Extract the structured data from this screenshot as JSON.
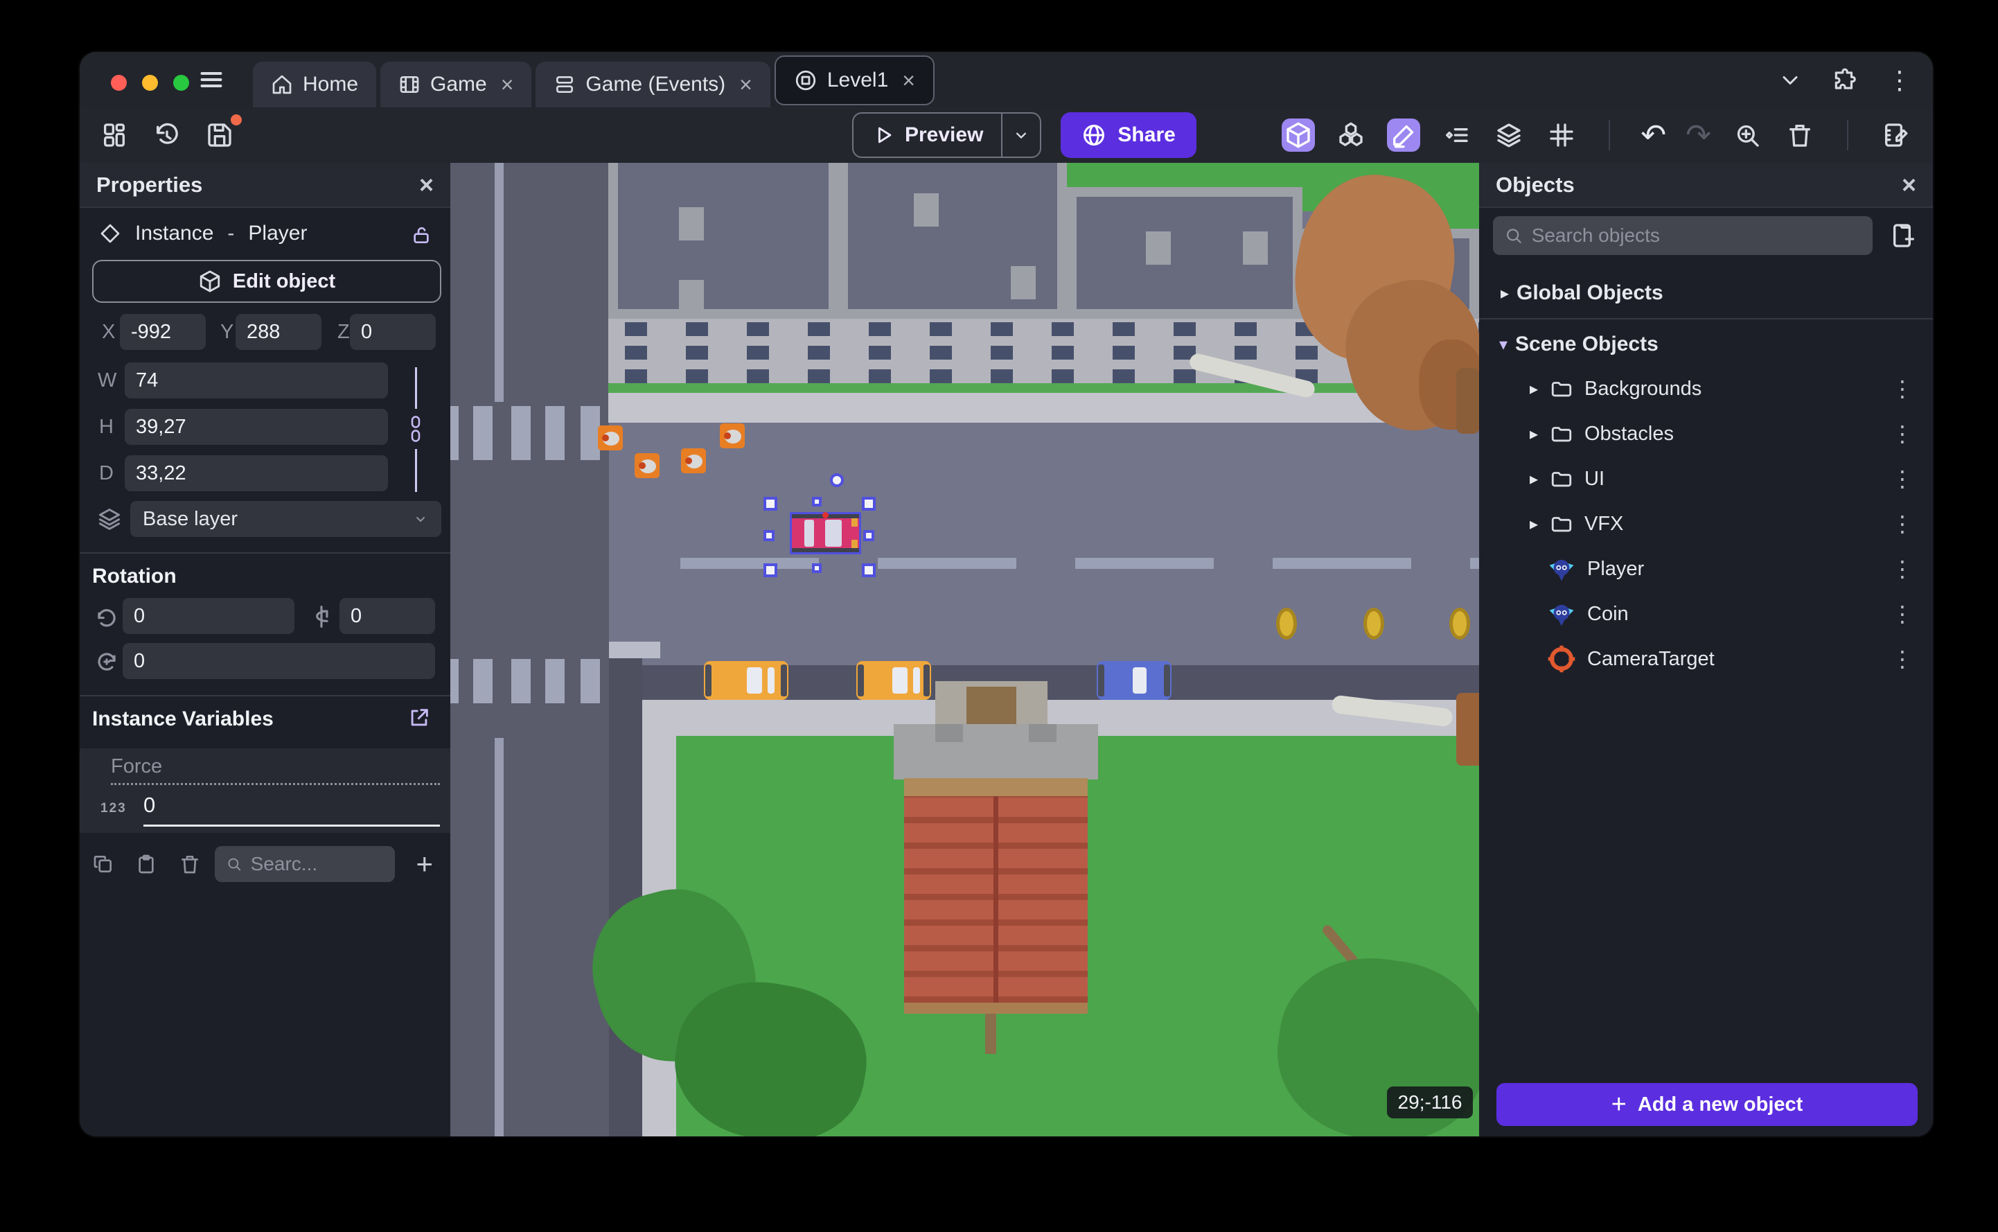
{
  "icons": {
    "close": "×",
    "kebab": "⋮",
    "chevron_right": "▸",
    "chevron_down": "▾",
    "plus": "+",
    "undo": "↶",
    "redo": "↷"
  },
  "tabs": [
    {
      "label": "Home"
    },
    {
      "label": "Game"
    },
    {
      "label": "Game (Events)"
    },
    {
      "label": "Level1"
    }
  ],
  "toolbar": {
    "preview": "Preview",
    "share": "Share"
  },
  "properties": {
    "title": "Properties",
    "instance_type": "Instance",
    "separator": "-",
    "instance_name": "Player",
    "edit_object": "Edit object",
    "labels": {
      "x": "X",
      "y": "Y",
      "z": "Z",
      "w": "W",
      "h": "H",
      "d": "D"
    },
    "x": "-992",
    "y": "288",
    "z": "0",
    "w": "74",
    "h": "39,27",
    "d": "33,22",
    "layer": "Base layer",
    "rotation_title": "Rotation",
    "rot_x": "0",
    "rot_y": "0",
    "rot_z": "0",
    "variables_title": "Instance Variables",
    "variable": {
      "name": "Force",
      "type": "123",
      "value": "0"
    },
    "search_placeholder": "Searc..."
  },
  "objects": {
    "title": "Objects",
    "search_placeholder": "Search objects",
    "global_group": "Global Objects",
    "scene_group": "Scene Objects",
    "tree": [
      {
        "label": "Backgrounds",
        "kind": "folder"
      },
      {
        "label": "Obstacles",
        "kind": "folder"
      },
      {
        "label": "UI",
        "kind": "folder"
      },
      {
        "label": "VFX",
        "kind": "folder"
      },
      {
        "label": "Player",
        "kind": "object"
      },
      {
        "label": "Coin",
        "kind": "object"
      },
      {
        "label": "CameraTarget",
        "kind": "camera"
      }
    ],
    "add_button": "Add a new object"
  },
  "canvas": {
    "coords_badge": "29;-116"
  },
  "colors": {
    "accent_purple": "#5B2EE0",
    "toolbar_highlight": "#9C88F0",
    "selection_blue": "#5050E0",
    "lawn_green": "#4CA64C",
    "road_grey": "#73758A",
    "coin_gold": "#D9B434",
    "cone_orange": "#E87E24",
    "player_car_pink": "#D8356F"
  }
}
